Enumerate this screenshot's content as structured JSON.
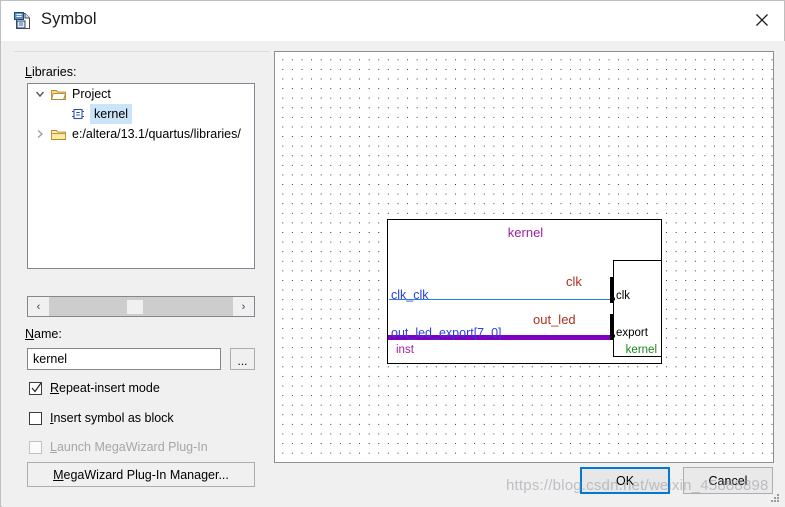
{
  "window": {
    "title": "Symbol",
    "icon": "symbol-document-icon",
    "close_label": "✕"
  },
  "libraries": {
    "label": "Libraries:",
    "label_accesskey": "L",
    "tree": [
      {
        "label": "Project",
        "icon": "open-folder-icon",
        "expander": "chevron-down-icon",
        "expanded": true,
        "indent": 0,
        "selected": false
      },
      {
        "label": "kernel",
        "icon": "symbol-block-icon",
        "expander": "",
        "expanded": false,
        "indent": 1,
        "selected": true
      },
      {
        "label": "e:/altera/13.1/quartus/libraries/",
        "icon": "closed-folder-icon",
        "expander": "chevron-right-icon",
        "expanded": false,
        "indent": 0,
        "selected": false
      }
    ],
    "scrollbar": {
      "left_arrow": "‹",
      "right_arrow": "›"
    }
  },
  "name_field": {
    "label": "Name:",
    "label_accesskey": "N",
    "value": "kernel",
    "placeholder": "",
    "browse_label": "..."
  },
  "options": [
    {
      "id": "repeat-insert-mode",
      "label": "Repeat-insert mode",
      "accesskey": "R",
      "checked": true,
      "disabled": false
    },
    {
      "id": "insert-symbol-as-block",
      "label": "Insert symbol as block",
      "accesskey": "I",
      "checked": false,
      "disabled": false
    },
    {
      "id": "launch-megawizard-plug-in",
      "label": "Launch MegaWizard Plug-In",
      "accesskey": "L",
      "checked": false,
      "disabled": true
    }
  ],
  "megawizard_button": {
    "label": "MegaWizard Plug-In Manager...",
    "accesskey": "M"
  },
  "preview": {
    "symbol_title": "kernel",
    "instance_name": "inst",
    "entity_name": "kernel",
    "signals": [
      {
        "name": "clk",
        "color": "#b03020"
      },
      {
        "name": "out_led",
        "color": "#b03020"
      }
    ],
    "pins": [
      {
        "name": "clk_clk",
        "color": "#2a3fe0",
        "type": "wire"
      },
      {
        "name": "out_led_export[7..0]",
        "color": "#2a3fe0",
        "type": "bus"
      }
    ],
    "ports": [
      {
        "name": "clk",
        "direction": "input"
      },
      {
        "name": "export",
        "direction": "output"
      }
    ],
    "colors": {
      "title": "#a020a0",
      "instance": "#a020a0",
      "entity": "#1a8a1a",
      "signal": "#b03020",
      "pin": "#2a3fe0",
      "wire": "#2a7fdd",
      "bus": "#8000c0"
    }
  },
  "footer": {
    "ok_label": "OK",
    "cancel_label": "Cancel"
  },
  "watermark": {
    "text": "https://blog.csdn.net/weixin_45888898"
  }
}
